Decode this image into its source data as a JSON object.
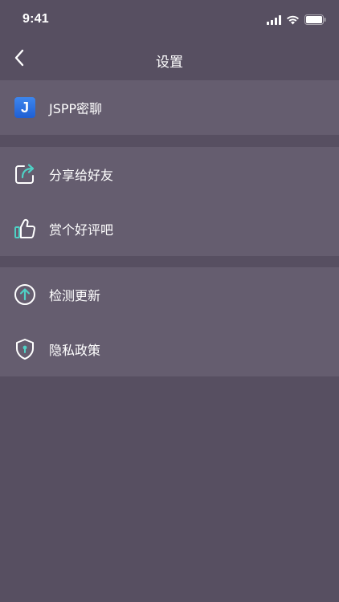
{
  "status_bar": {
    "time": "9:41",
    "icons": [
      "signal-icon",
      "wifi-icon",
      "battery-icon"
    ]
  },
  "nav": {
    "title": "设置",
    "back_icon": "chevron-left-icon"
  },
  "app_section": {
    "app_badge_letter": "J",
    "app_name": "JSPP密聊"
  },
  "social_section": {
    "items": [
      {
        "label": "分享给好友",
        "icon": "share-icon"
      },
      {
        "label": "赏个好评吧",
        "icon": "thumbs-up-icon"
      }
    ]
  },
  "misc_section": {
    "items": [
      {
        "label": "检测更新",
        "icon": "update-arrow-icon"
      },
      {
        "label": "隐私政策",
        "icon": "privacy-shield-icon"
      }
    ]
  },
  "colors": {
    "background": "#574f61",
    "section_background": "#655d6f",
    "icon_stroke": "#ffffff",
    "icon_accent": "#4fd1c5",
    "app_badge": "#2f74e4"
  }
}
